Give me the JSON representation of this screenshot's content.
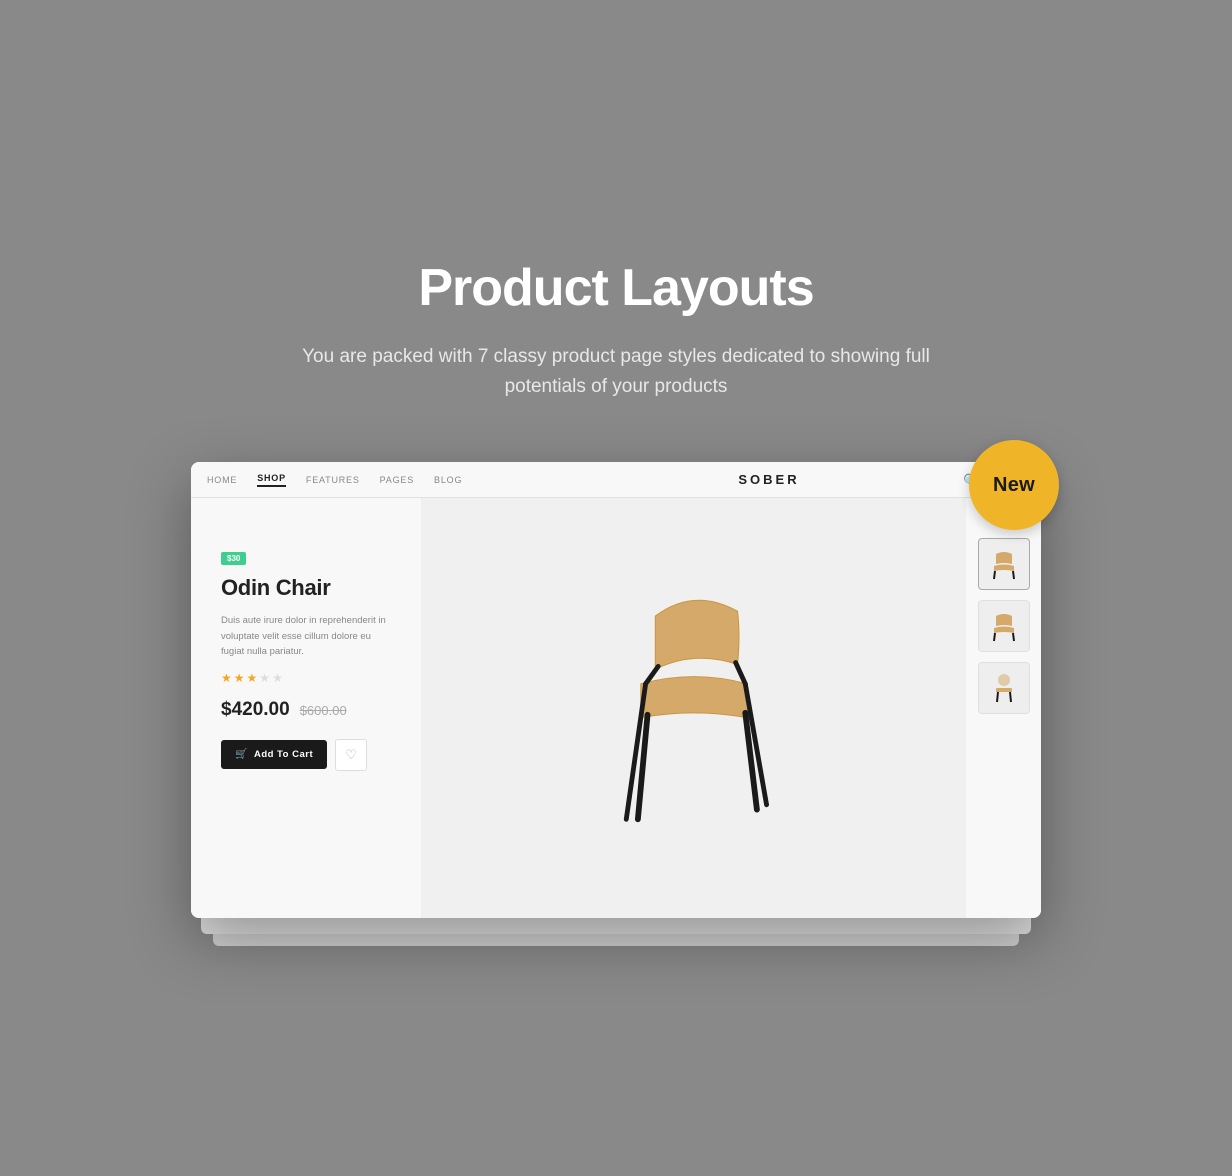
{
  "page": {
    "background": "#898989"
  },
  "header": {
    "title": "Product Layouts",
    "subtitle": "You are packed with 7 classy product page styles dedicated to showing full potentials of your products"
  },
  "badge": {
    "label": "New",
    "color": "#f0b429"
  },
  "browser": {
    "nav": {
      "items": [
        {
          "label": "HOME",
          "active": false
        },
        {
          "label": "SHOP",
          "active": true
        },
        {
          "label": "FEATURES",
          "active": false
        },
        {
          "label": "PAGES",
          "active": false
        },
        {
          "label": "BLOG",
          "active": false
        }
      ],
      "brand": "SOBER"
    }
  },
  "product": {
    "badge": "$30",
    "name": "Odin Chair",
    "description": "Duis aute irure dolor in reprehenderit in voluptate velit esse cillum dolore eu fugiat nulla pariatur.",
    "rating": 3,
    "max_rating": 5,
    "price": "$420.00",
    "original_price": "$600.00",
    "add_to_cart": "Add To Cart"
  }
}
